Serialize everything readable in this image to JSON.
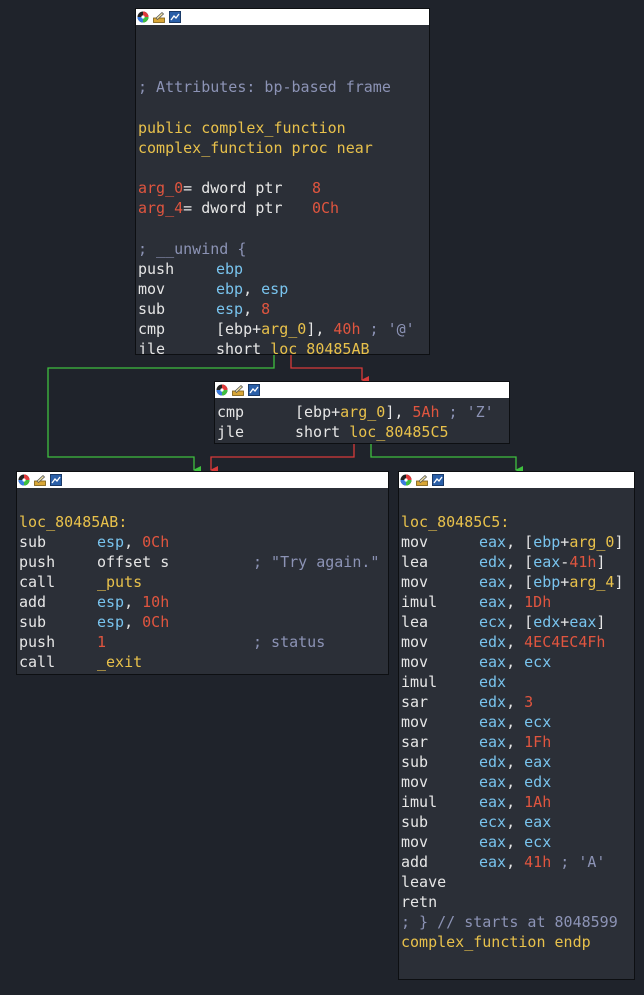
{
  "colors": {
    "background": "#1f232b",
    "node_bg": "#2b2f37",
    "titlebar": "#ffffff",
    "edge_false": "#d83a3a",
    "edge_true": "#3fbf3f",
    "edge_unconditional": "#66ccee"
  },
  "icons": [
    "color-palette-icon",
    "rename-icon",
    "graph-icon"
  ],
  "node1": {
    "comment_attrs": "; Attributes: bp-based frame",
    "public_decl": "public complex_function",
    "proc_decl": "complex_function proc near",
    "arg0_name": "arg_0",
    "arg0_type": "= dword ptr",
    "arg0_val": "8",
    "arg4_name": "arg_4",
    "arg4_type": "= dword ptr",
    "arg4_val": "0Ch",
    "unwind": "; __unwind {",
    "l1_mn": "push",
    "l1_op": "ebp",
    "l2_mn": "mov",
    "l2_op1": "ebp",
    "l2_sep": ", ",
    "l2_op2": "esp",
    "l3_mn": "sub",
    "l3_op1": "esp",
    "l3_sep": ", ",
    "l3_op2": "8",
    "l4_mn": "cmp",
    "l4_a": "[ebp+",
    "l4_b": "arg_0",
    "l4_c": "], ",
    "l4_d": "40h",
    "l4_e": " ; '@'",
    "l5_mn": "jle",
    "l5_a": "short ",
    "l5_b": "loc_80485AB"
  },
  "node2": {
    "l1_mn": "cmp",
    "l1_a": "[ebp+",
    "l1_b": "arg_0",
    "l1_c": "], ",
    "l1_d": "5Ah",
    "l1_e": " ; 'Z'",
    "l2_mn": "jle",
    "l2_a": "short ",
    "l2_b": "loc_80485C5"
  },
  "node3": {
    "label": "loc_80485AB:",
    "l1_mn": "sub",
    "l1_op1": "esp",
    "l1_sep": ", ",
    "l1_op2": "0Ch",
    "l2_mn": "push",
    "l2_op": "offset s",
    "l2_cmt": "; \"Try again.\"",
    "l3_mn": "call",
    "l3_op": "_puts",
    "l4_mn": "add",
    "l4_op1": "esp",
    "l4_sep": ", ",
    "l4_op2": "10h",
    "l5_mn": "sub",
    "l5_op1": "esp",
    "l5_sep": ", ",
    "l5_op2": "0Ch",
    "l6_mn": "push",
    "l6_op": "1",
    "l6_cmt": "; status",
    "l7_mn": "call",
    "l7_op": "_exit"
  },
  "node4": {
    "label": "loc_80485C5:",
    "lines": [
      {
        "mn": "mov",
        "op": [
          [
            "reg",
            "eax"
          ],
          [
            "p",
            ", ["
          ],
          [
            "reg",
            "ebp"
          ],
          [
            "p",
            "+"
          ],
          [
            "kw",
            "arg_0"
          ],
          [
            "p",
            "]"
          ]
        ]
      },
      {
        "mn": "lea",
        "op": [
          [
            "reg",
            "edx"
          ],
          [
            "p",
            ", ["
          ],
          [
            "reg",
            "eax"
          ],
          [
            "p",
            "-"
          ],
          [
            "num",
            "41h"
          ],
          [
            "p",
            "]"
          ]
        ]
      },
      {
        "mn": "mov",
        "op": [
          [
            "reg",
            "eax"
          ],
          [
            "p",
            ", ["
          ],
          [
            "reg",
            "ebp"
          ],
          [
            "p",
            "+"
          ],
          [
            "kw",
            "arg_4"
          ],
          [
            "p",
            "]"
          ]
        ]
      },
      {
        "mn": "imul",
        "op": [
          [
            "reg",
            "eax"
          ],
          [
            "p",
            ", "
          ],
          [
            "num",
            "1Dh"
          ]
        ]
      },
      {
        "mn": "lea",
        "op": [
          [
            "reg",
            "ecx"
          ],
          [
            "p",
            ", ["
          ],
          [
            "reg",
            "edx"
          ],
          [
            "p",
            "+"
          ],
          [
            "reg",
            "eax"
          ],
          [
            "p",
            "]"
          ]
        ]
      },
      {
        "mn": "mov",
        "op": [
          [
            "reg",
            "edx"
          ],
          [
            "p",
            ", "
          ],
          [
            "num",
            "4EC4EC4Fh"
          ]
        ]
      },
      {
        "mn": "mov",
        "op": [
          [
            "reg",
            "eax"
          ],
          [
            "p",
            ", "
          ],
          [
            "reg",
            "ecx"
          ]
        ]
      },
      {
        "mn": "imul",
        "op": [
          [
            "reg",
            "edx"
          ]
        ]
      },
      {
        "mn": "sar",
        "op": [
          [
            "reg",
            "edx"
          ],
          [
            "p",
            ", "
          ],
          [
            "num",
            "3"
          ]
        ]
      },
      {
        "mn": "mov",
        "op": [
          [
            "reg",
            "eax"
          ],
          [
            "p",
            ", "
          ],
          [
            "reg",
            "ecx"
          ]
        ]
      },
      {
        "mn": "sar",
        "op": [
          [
            "reg",
            "eax"
          ],
          [
            "p",
            ", "
          ],
          [
            "num",
            "1Fh"
          ]
        ]
      },
      {
        "mn": "sub",
        "op": [
          [
            "reg",
            "edx"
          ],
          [
            "p",
            ", "
          ],
          [
            "reg",
            "eax"
          ]
        ]
      },
      {
        "mn": "mov",
        "op": [
          [
            "reg",
            "eax"
          ],
          [
            "p",
            ", "
          ],
          [
            "reg",
            "edx"
          ]
        ]
      },
      {
        "mn": "imul",
        "op": [
          [
            "reg",
            "eax"
          ],
          [
            "p",
            ", "
          ],
          [
            "num",
            "1Ah"
          ]
        ]
      },
      {
        "mn": "sub",
        "op": [
          [
            "reg",
            "ecx"
          ],
          [
            "p",
            ", "
          ],
          [
            "reg",
            "eax"
          ]
        ]
      },
      {
        "mn": "mov",
        "op": [
          [
            "reg",
            "eax"
          ],
          [
            "p",
            ", "
          ],
          [
            "reg",
            "ecx"
          ]
        ]
      },
      {
        "mn": "add",
        "op": [
          [
            "reg",
            "eax"
          ],
          [
            "p",
            ", "
          ],
          [
            "num",
            "41h"
          ],
          [
            "cmt",
            " ; 'A'"
          ]
        ]
      },
      {
        "mn": "leave",
        "op": []
      },
      {
        "mn": "retn",
        "op": []
      }
    ],
    "end_comment": "; } // starts at 8048599",
    "endp": "complex_function endp"
  }
}
